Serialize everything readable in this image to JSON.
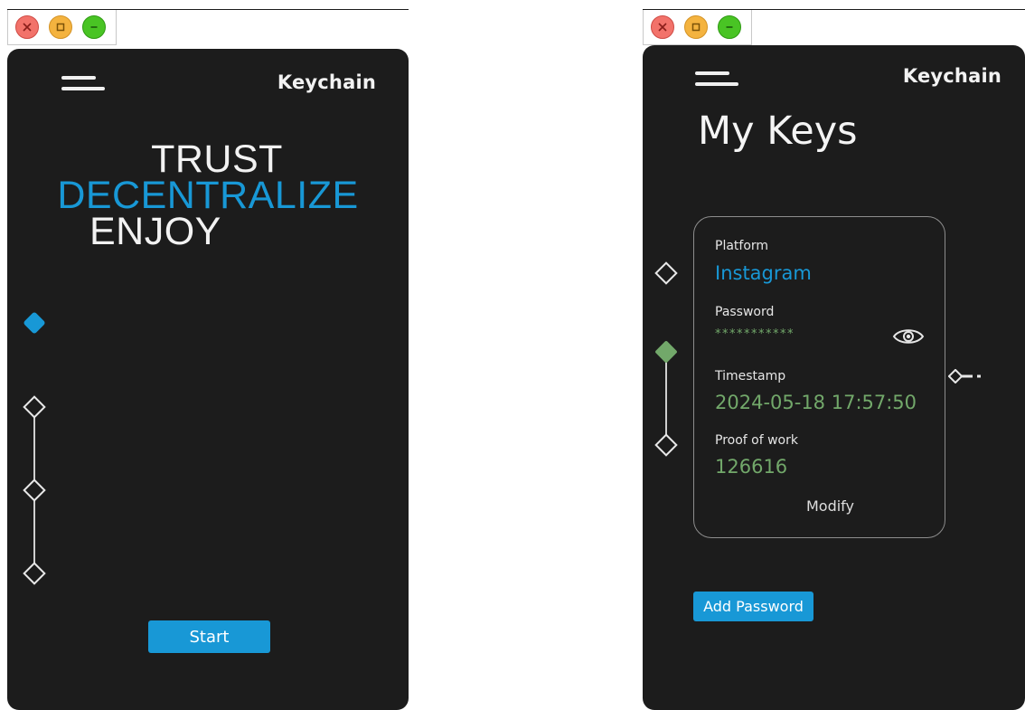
{
  "colors": {
    "accent_blue": "#1898d6",
    "accent_green": "#72a86a",
    "panel_bg": "#1c1c1c"
  },
  "window_controls": [
    "close-icon",
    "maximize-icon",
    "minimize-icon"
  ],
  "welcome_screen": {
    "brand": "Keychain",
    "hero_lines": [
      "TRUST",
      "DECENTRALIZE",
      "ENJOY"
    ],
    "start_label": "Start",
    "steps": 4,
    "active_step": 1
  },
  "keys_screen": {
    "brand": "Keychain",
    "title": "My Keys",
    "card": {
      "platform_label": "Platform",
      "platform_value": "Instagram",
      "password_label": "Password",
      "password_value": "***********",
      "timestamp_label": "Timestamp",
      "timestamp_value": "2024-05-18 17:57:50",
      "pow_label": "Proof of work",
      "pow_value": "126616",
      "modify_label": "Modify"
    },
    "add_password_label": "Add Password",
    "steps": 3,
    "active_step": 2
  }
}
